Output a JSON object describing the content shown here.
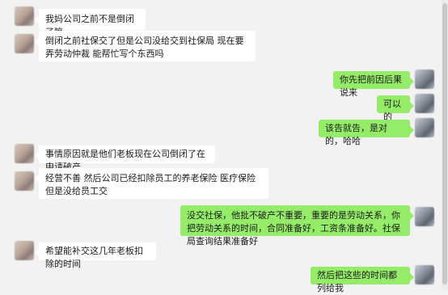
{
  "messages": [
    {
      "side": "left",
      "text": "我妈公司之前不是倒闭了嘛"
    },
    {
      "side": "left",
      "text": "倒闭之前社保交了但是公司没给交到社保局 现在要弄劳动仲裁 能帮忙写个东西吗"
    },
    {
      "side": "right",
      "text": "你先把前因后果说来"
    },
    {
      "side": "right",
      "text": "可以的"
    },
    {
      "side": "right",
      "text": "该告就告，是对的，哈哈"
    },
    {
      "side": "left",
      "text": "事情原因就是他们老板现在公司倒闭了在申请破产"
    },
    {
      "side": "left",
      "text": "经营不善 然后公司已经扣除员工的养老保险 医疗保险 但是没给员工交"
    },
    {
      "side": "right",
      "text": "没交社保，他批不破产不重要，重要的是劳动关系，你把劳动关系的时间，合同准备好，工资条准备好。社保局查询结果准备好"
    },
    {
      "side": "left",
      "text": "希望能补交这几年老板扣除的时间"
    },
    {
      "side": "right",
      "text": "然后把这些的时间都列给我"
    }
  ]
}
